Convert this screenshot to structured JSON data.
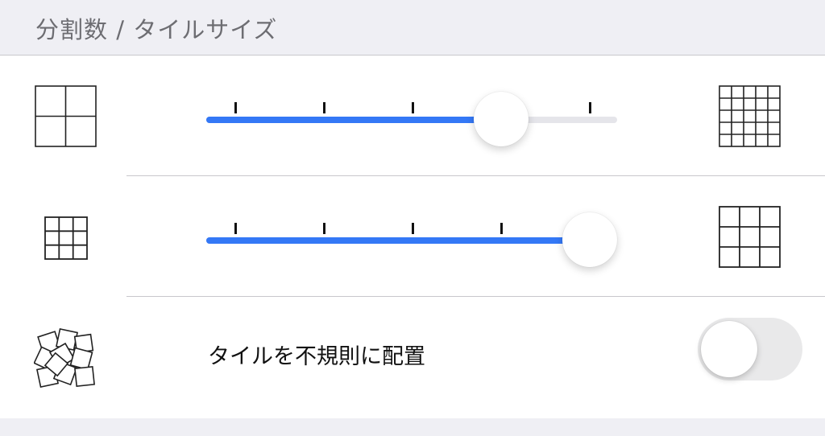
{
  "header": {
    "title": "分割数 / タイルサイズ"
  },
  "rows": [
    {
      "kind": "slider",
      "left_icon": "grid-2x2-icon",
      "right_icon": "grid-5x5-icon",
      "value": 0.72,
      "tick_count": 5
    },
    {
      "kind": "slider",
      "left_icon": "small-grid-3x3-icon",
      "right_icon": "large-grid-3x3-icon",
      "value": 0.94,
      "tick_count": 5
    },
    {
      "kind": "toggle",
      "icon": "scattered-tiles-icon",
      "label": "タイルを不規則に配置",
      "on": false
    }
  ],
  "colors": {
    "accent": "#3478f6",
    "separator": "#c8c7cc",
    "background": "#efeff4"
  }
}
